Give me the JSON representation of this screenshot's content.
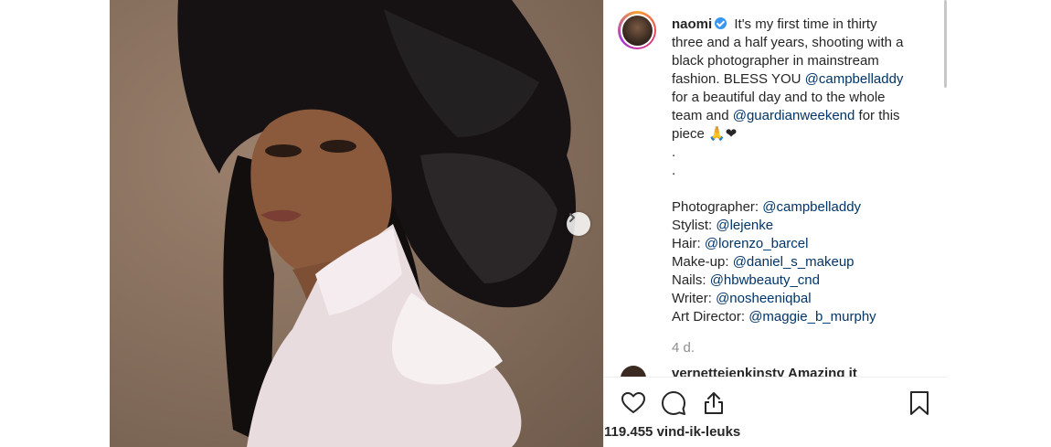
{
  "post": {
    "username": "naomi",
    "verified": true,
    "caption_lines": [
      " It's my first time in thirty",
      "three and a half years, shooting with a",
      "black photographer in mainstream",
      "fashion.  BLESS YOU ",
      "for a beautiful day and to the whole",
      "team and ",
      "piece 🙏❤",
      ".",
      "."
    ],
    "mentions": {
      "campbell": "@campbelladdy",
      "guardian": "@guardianweekend"
    },
    "caption_suffix": " for this",
    "credits": [
      {
        "label": "Photographer: ",
        "handle": "@campbelladdy"
      },
      {
        "label": "Stylist: ",
        "handle": "@lejenke"
      },
      {
        "label": "Hair: ",
        "handle": "@lorenzo_barcel"
      },
      {
        "label": "Make-up: ",
        "handle": "@daniel_s_makeup"
      },
      {
        "label": "Nails: ",
        "handle": "@hbwbeauty_cnd"
      },
      {
        "label": "Writer: ",
        "handle": "@nosheeniqbal"
      },
      {
        "label": "Art Director: ",
        "handle": "@maggie_b_murphy"
      }
    ],
    "age": "4 d.",
    "next_comment": "vernettejenkinsty Amazing it",
    "likes_count": "119.455",
    "likes_label": " vind-ik-leuks"
  },
  "icons": {
    "like": "heart-icon",
    "comment": "comment-icon",
    "share": "share-icon",
    "save": "bookmark-icon",
    "next": "chevron-right-icon"
  },
  "colors": {
    "mention": "#003569",
    "verified": "#3897f0",
    "muted": "#8e8e8e"
  }
}
